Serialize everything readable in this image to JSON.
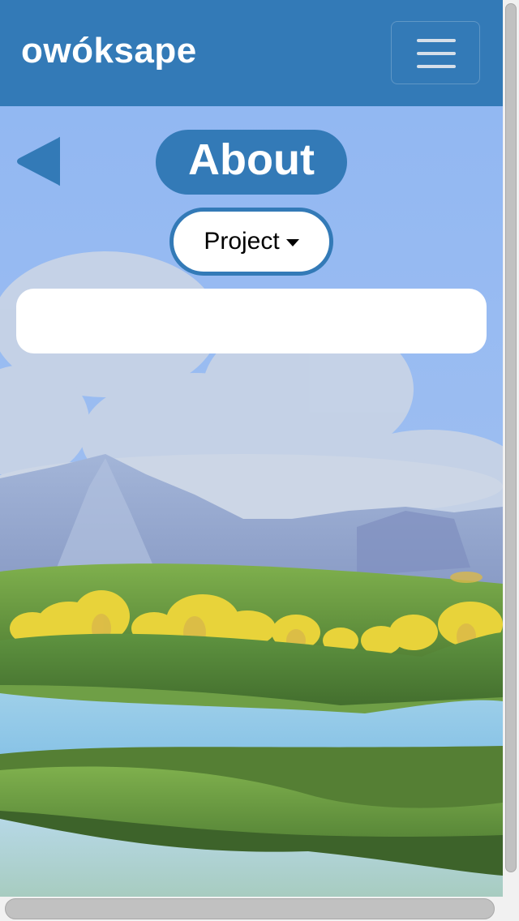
{
  "navbar": {
    "brand": "owóksape",
    "background_color": "#337ab7",
    "menu_icon": "hamburger-icon"
  },
  "header": {
    "back_icon": "back-arrow-icon",
    "title": "About"
  },
  "dropdown": {
    "selected_label": "Project",
    "caret_icon": "caret-down-icon"
  },
  "content_panel": {
    "text": ""
  },
  "colors": {
    "accent": "#337ab7",
    "sky": "#96bbf2",
    "panel": "#ffffff"
  }
}
